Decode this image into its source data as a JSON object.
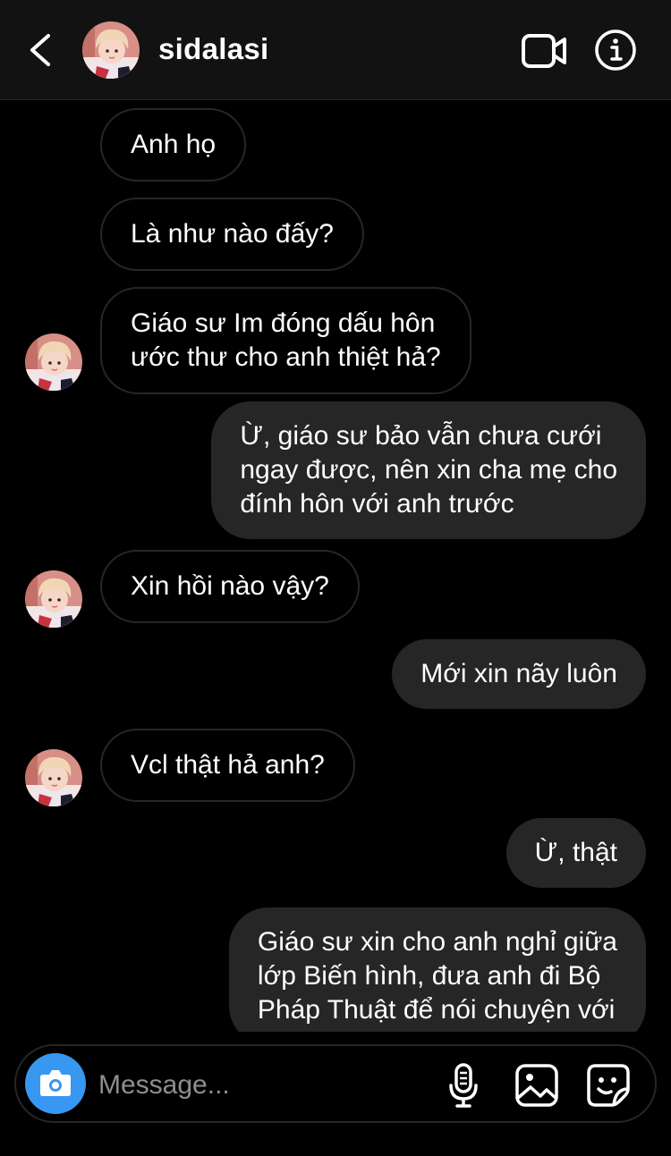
{
  "header": {
    "username": "sidalasi",
    "icons": {
      "back": "back-arrow-icon",
      "video": "video-camera-icon",
      "info": "info-icon"
    }
  },
  "messages": [
    {
      "direction": "incoming",
      "text": "Anh họ",
      "show_avatar": false
    },
    {
      "direction": "incoming",
      "text": "Là như nào đấy?",
      "show_avatar": false
    },
    {
      "direction": "incoming",
      "text": "Giáo sư Im đóng dấu hôn\nước thư cho anh thiệt hả?",
      "show_avatar": true
    },
    {
      "direction": "outgoing",
      "text": "Ừ, giáo sư bảo vẫn chưa cưới\nngay được, nên xin cha mẹ cho\nđính hôn với anh trước"
    },
    {
      "direction": "incoming",
      "text": "Xin hồi nào vậy?",
      "show_avatar": true
    },
    {
      "direction": "outgoing",
      "text": "Mới xin nãy luôn"
    },
    {
      "direction": "incoming",
      "text": "Vcl thật hả anh?",
      "show_avatar": true
    },
    {
      "direction": "outgoing",
      "text": "Ừ, thật"
    },
    {
      "direction": "outgoing",
      "text": "Giáo sư xin cho anh nghỉ giữa\nlớp Biến hình, đưa anh đi Bộ\nPháp Thuật để nói chuyện với"
    }
  ],
  "composer": {
    "placeholder": "Message...",
    "icons": {
      "camera": "camera-icon",
      "mic": "microphone-icon",
      "gallery": "gallery-icon",
      "sticker": "sticker-icon"
    }
  },
  "colors": {
    "background": "#000000",
    "header": "#121212",
    "outgoing_bubble": "#262626",
    "incoming_border": "#262626",
    "camera_button": "#3897f0",
    "placeholder": "#8e8e8e"
  }
}
